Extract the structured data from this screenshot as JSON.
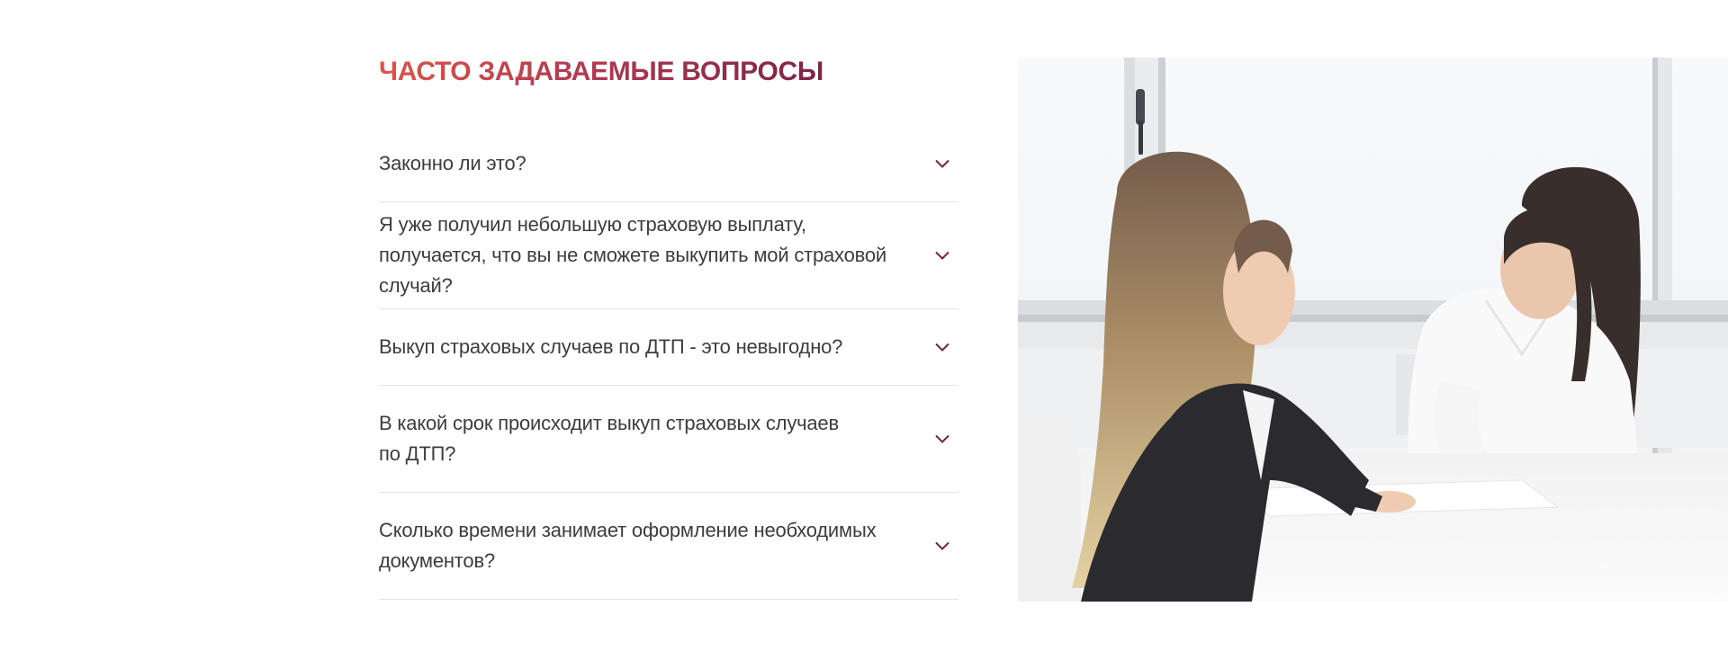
{
  "faq": {
    "title": "ЧАСТО ЗАДАВАЕМЫЕ ВОПРОСЫ",
    "items": [
      {
        "question": "Законно ли это?"
      },
      {
        "question": "Я уже получил небольшую страховую выплату, получается, что вы не сможете выкупить мой страховой случай?"
      },
      {
        "question": "Выкуп страховых случаев по ДТП - это невыгодно?"
      },
      {
        "question": "В какой срок происходит выкуп страховых случаев по ДТП?"
      },
      {
        "question": "Сколько времени занимает оформление необходимых документов?"
      }
    ]
  },
  "theme": {
    "title_gradient": [
      "#dc5549",
      "#b43a50",
      "#7d2447"
    ],
    "chevron_color": "#7a1f45",
    "divider_color": "#e3e3e3"
  },
  "icons": {
    "toggle": "chevron-down-icon"
  }
}
